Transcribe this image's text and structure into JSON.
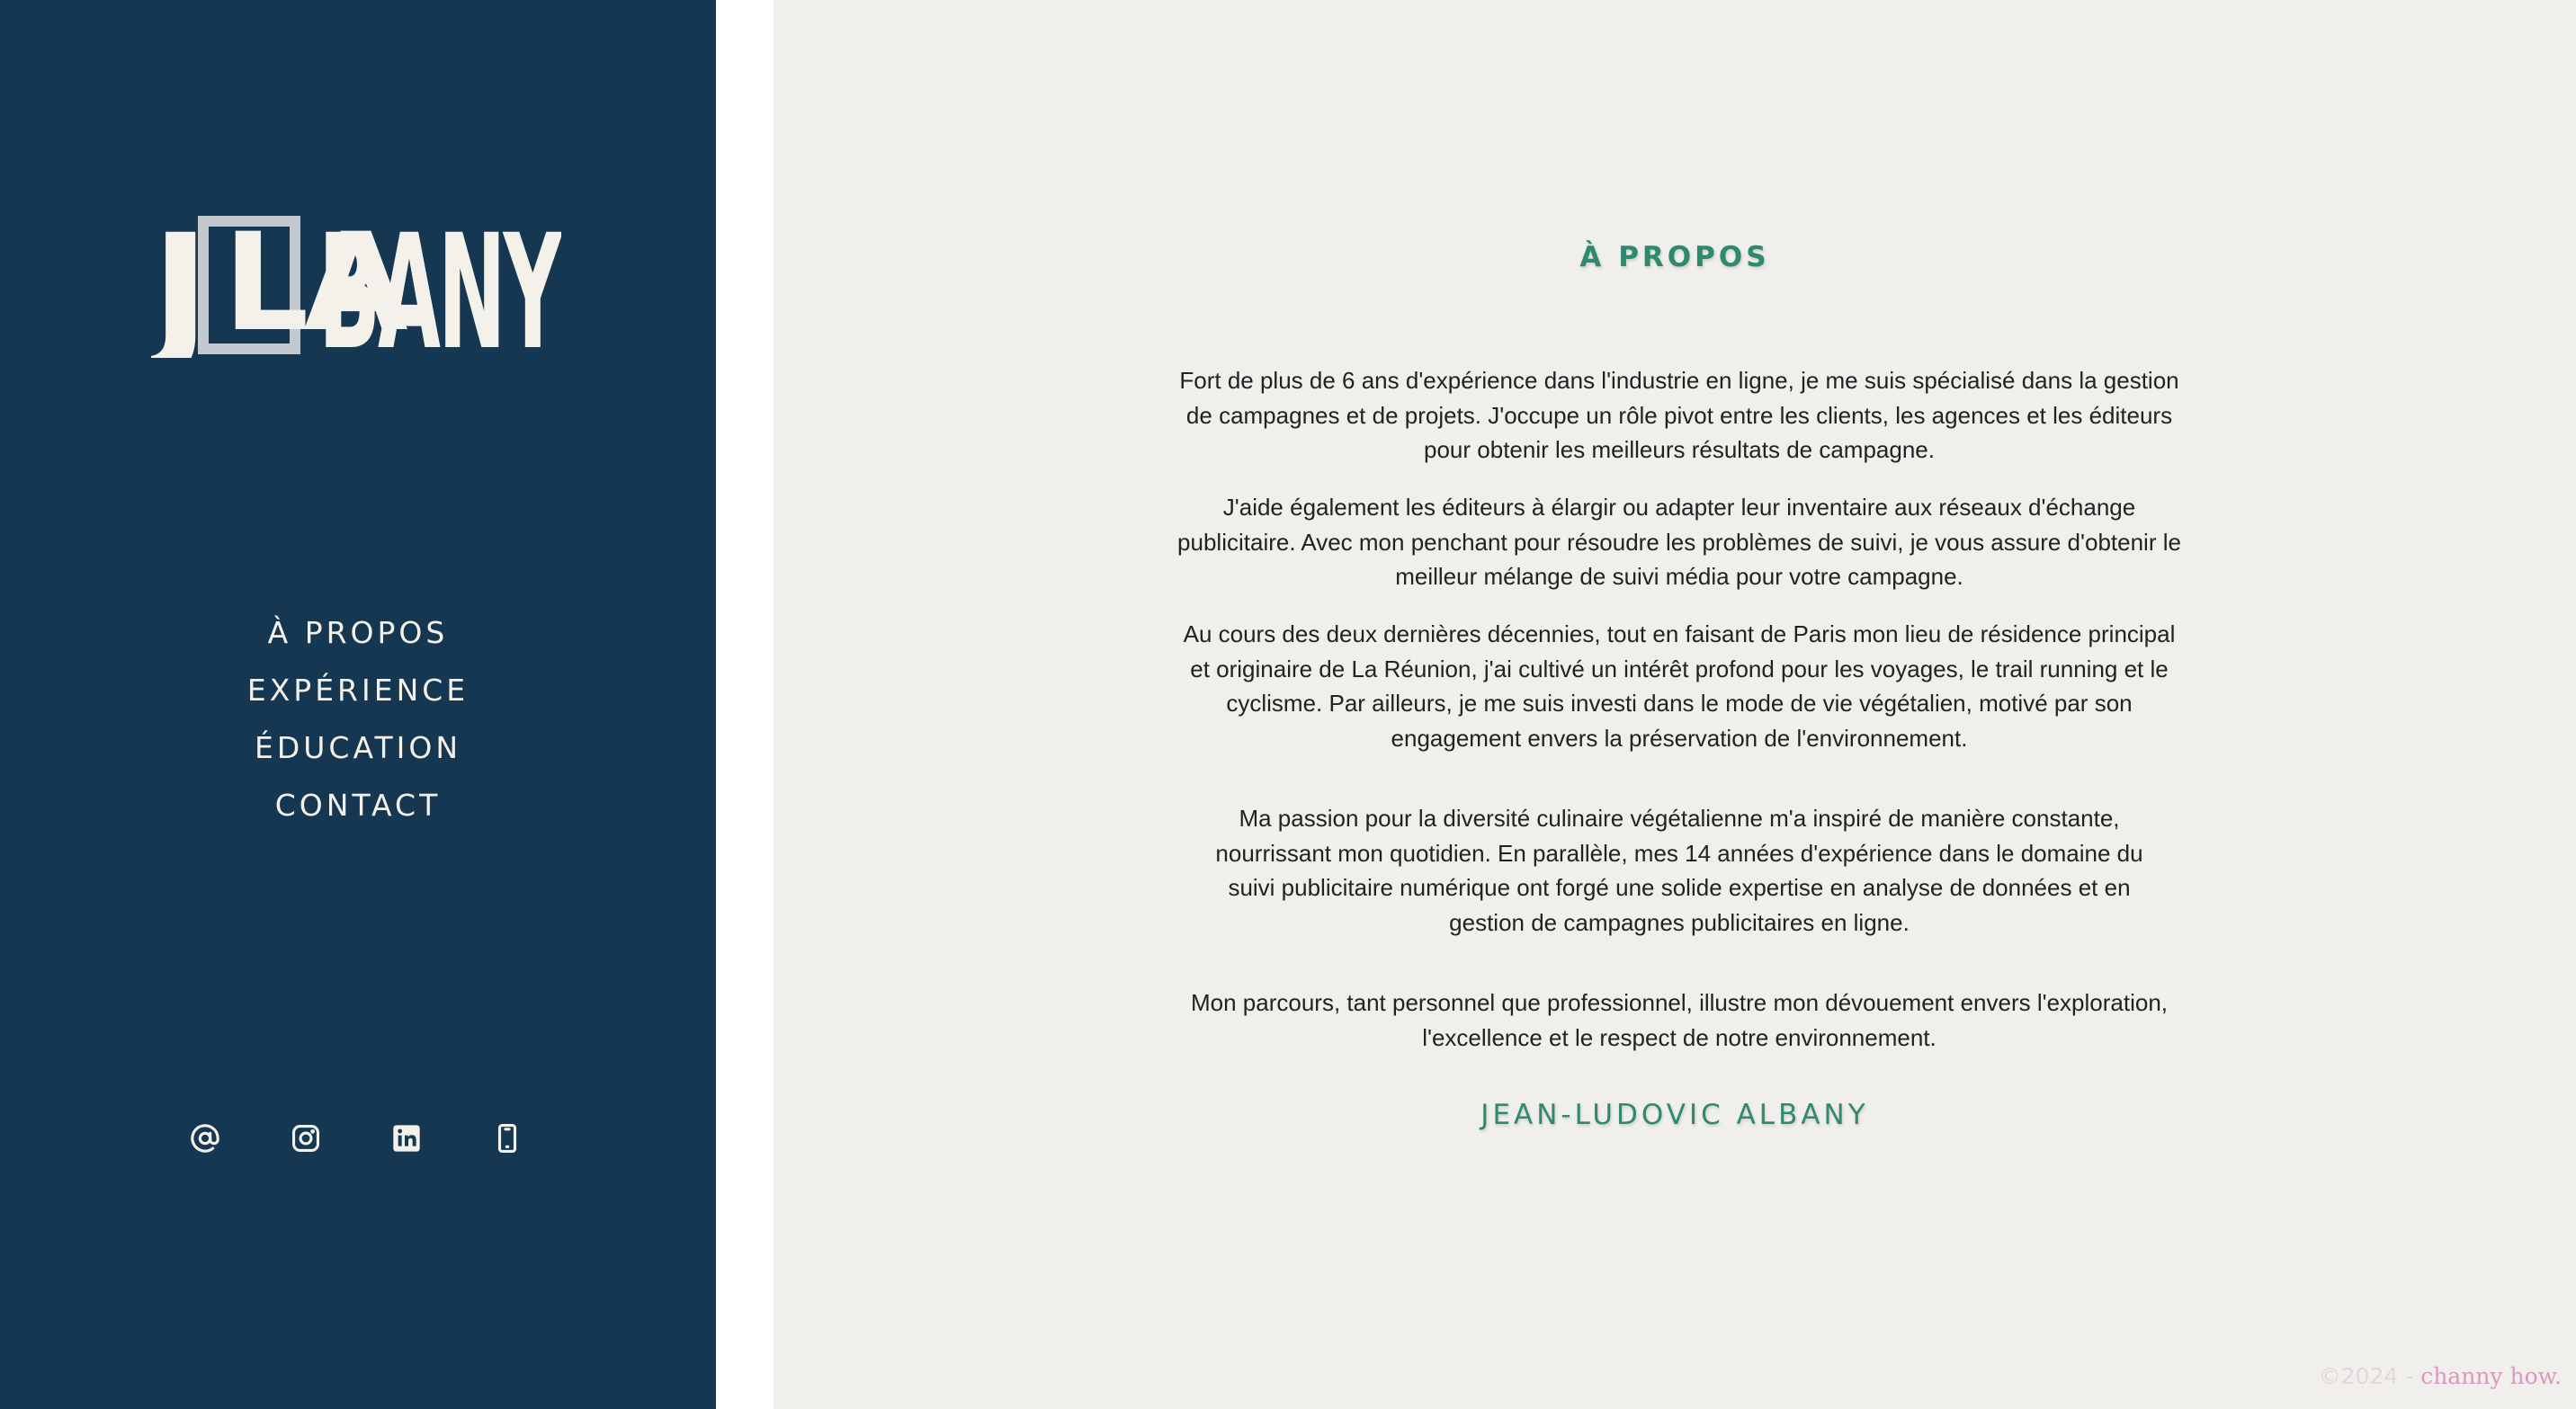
{
  "sidebar": {
    "logo": {
      "text": "JLABANY",
      "letters": {
        "j": "J",
        "boxed": "LA",
        "rest": "BANY"
      }
    },
    "nav": [
      {
        "label": "À PROPOS"
      },
      {
        "label": "EXPÉRIENCE"
      },
      {
        "label": "ÉDUCATION"
      },
      {
        "label": "CONTACT"
      }
    ],
    "social": [
      {
        "icon": "at-sign-icon",
        "title": "Email"
      },
      {
        "icon": "instagram-icon",
        "title": "Instagram"
      },
      {
        "icon": "linkedin-icon",
        "title": "LinkedIn"
      },
      {
        "icon": "phone-icon",
        "title": "Téléphone"
      }
    ],
    "colors": {
      "background": "#153752",
      "text": "#f4f1ea",
      "logo_box": "#c4c9cf"
    }
  },
  "main": {
    "heading": "À PROPOS",
    "paragraphs": [
      [
        "Fort de plus de 6 ans d'expérience dans l'industrie en ligne, je me suis spécialisé dans la gestion",
        "de campagnes et de projets. J'occupe un rôle pivot entre les clients, les agences et les éditeurs",
        "pour obtenir les meilleurs résultats de campagne."
      ],
      [
        "J'aide également les éditeurs à élargir ou adapter leur inventaire aux réseaux d'échange",
        "publicitaire. Avec mon penchant pour résoudre les problèmes de suivi, je vous assure d'obtenir le",
        "meilleur mélange de suivi média pour votre campagne."
      ],
      [
        "Au cours des deux dernières décennies, tout en faisant de Paris mon lieu de résidence principal",
        "et originaire de La Réunion, j'ai cultivé un intérêt profond pour les voyages, le trail running et le",
        "cyclisme. Par ailleurs, je me suis investi dans le mode de vie végétalien, motivé par son",
        "engagement envers la préservation de l'environnement."
      ],
      [
        "Ma passion pour la diversité culinaire végétalienne m'a inspiré de manière constante,",
        "nourrissant mon quotidien. En parallèle, mes 14 années d'expérience dans le domaine du",
        "suivi publicitaire numérique ont forgé une solide expertise en analyse de données et en",
        "gestion de campagnes publicitaires en ligne."
      ],
      [
        "Mon parcours, tant personnel que professionnel, illustre mon dévouement envers l'exploration,",
        "l'excellence et le respect de notre environnement."
      ]
    ],
    "signature": "JEAN-LUDOVIC ALBANY",
    "colors": {
      "background": "#f1efeb",
      "accent": "#2e8a6e",
      "text": "#222222"
    }
  },
  "footer": {
    "copyright": "©2024 - ",
    "brand": "channy how."
  }
}
